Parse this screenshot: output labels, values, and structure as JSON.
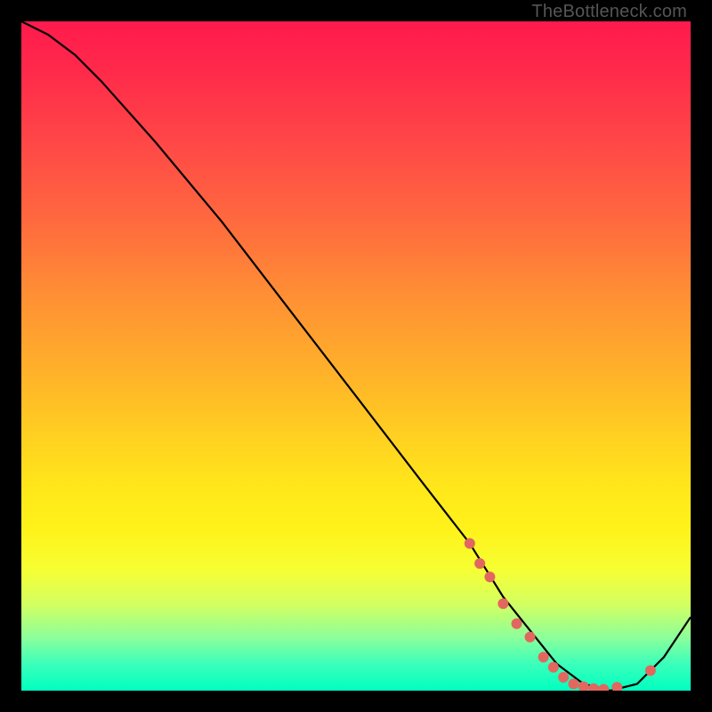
{
  "watermark": "TheBottleneck.com",
  "colors": {
    "background": "#000000",
    "curve": "#000000",
    "dots": "#e2675f"
  },
  "chart_data": {
    "type": "line",
    "title": "",
    "xlabel": "",
    "ylabel": "",
    "xlim": [
      0,
      100
    ],
    "ylim": [
      0,
      100
    ],
    "grid": false,
    "legend": false,
    "series": [
      {
        "name": "curve",
        "x": [
          0,
          4,
          8,
          12,
          20,
          30,
          40,
          50,
          60,
          67,
          72,
          76,
          80,
          84,
          88,
          92,
          96,
          100
        ],
        "y": [
          100,
          98,
          95,
          91,
          82,
          70,
          57,
          44,
          31,
          22,
          14,
          9,
          4,
          1,
          0,
          1,
          5,
          11
        ]
      }
    ],
    "markers": [
      {
        "x": 67,
        "y": 22
      },
      {
        "x": 68.5,
        "y": 19
      },
      {
        "x": 70,
        "y": 17
      },
      {
        "x": 72,
        "y": 13
      },
      {
        "x": 74,
        "y": 10
      },
      {
        "x": 76,
        "y": 8
      },
      {
        "x": 78,
        "y": 5
      },
      {
        "x": 79.5,
        "y": 3.5
      },
      {
        "x": 81,
        "y": 2
      },
      {
        "x": 82.5,
        "y": 1
      },
      {
        "x": 84,
        "y": 0.6
      },
      {
        "x": 85.5,
        "y": 0.3
      },
      {
        "x": 87,
        "y": 0.2
      },
      {
        "x": 89,
        "y": 0.5
      },
      {
        "x": 94,
        "y": 3
      }
    ]
  }
}
